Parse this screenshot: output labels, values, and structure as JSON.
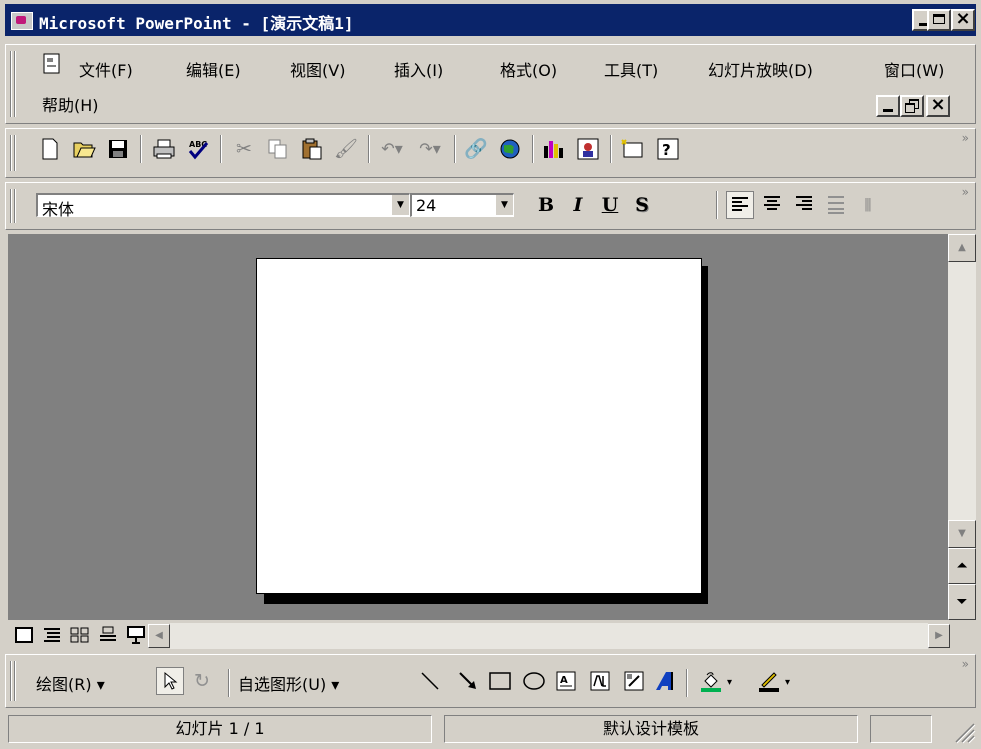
{
  "window": {
    "title": "Microsoft PowerPoint - [演示文稿1]"
  },
  "menu": {
    "items": [
      "文件(F)",
      "编辑(E)",
      "视图(V)",
      "插入(I)",
      "格式(O)",
      "工具(T)",
      "幻灯片放映(D)",
      "窗口(W)",
      "帮助(H)"
    ]
  },
  "formatting": {
    "font_name": "宋体",
    "font_size": "24",
    "bold": "B",
    "italic": "I",
    "underline": "U",
    "shadow": "S"
  },
  "drawing_toolbar": {
    "draw_label": "绘图(R)",
    "autoshapes_label": "自选图形(U)"
  },
  "status": {
    "slide_counter": "幻灯片 1 / 1",
    "design_template": "默认设计模板"
  },
  "colors": {
    "titlebar": "#0a246a",
    "workspace": "#808080",
    "fill_color_swatch": "#00b050",
    "line_color_swatch": "#000000"
  }
}
